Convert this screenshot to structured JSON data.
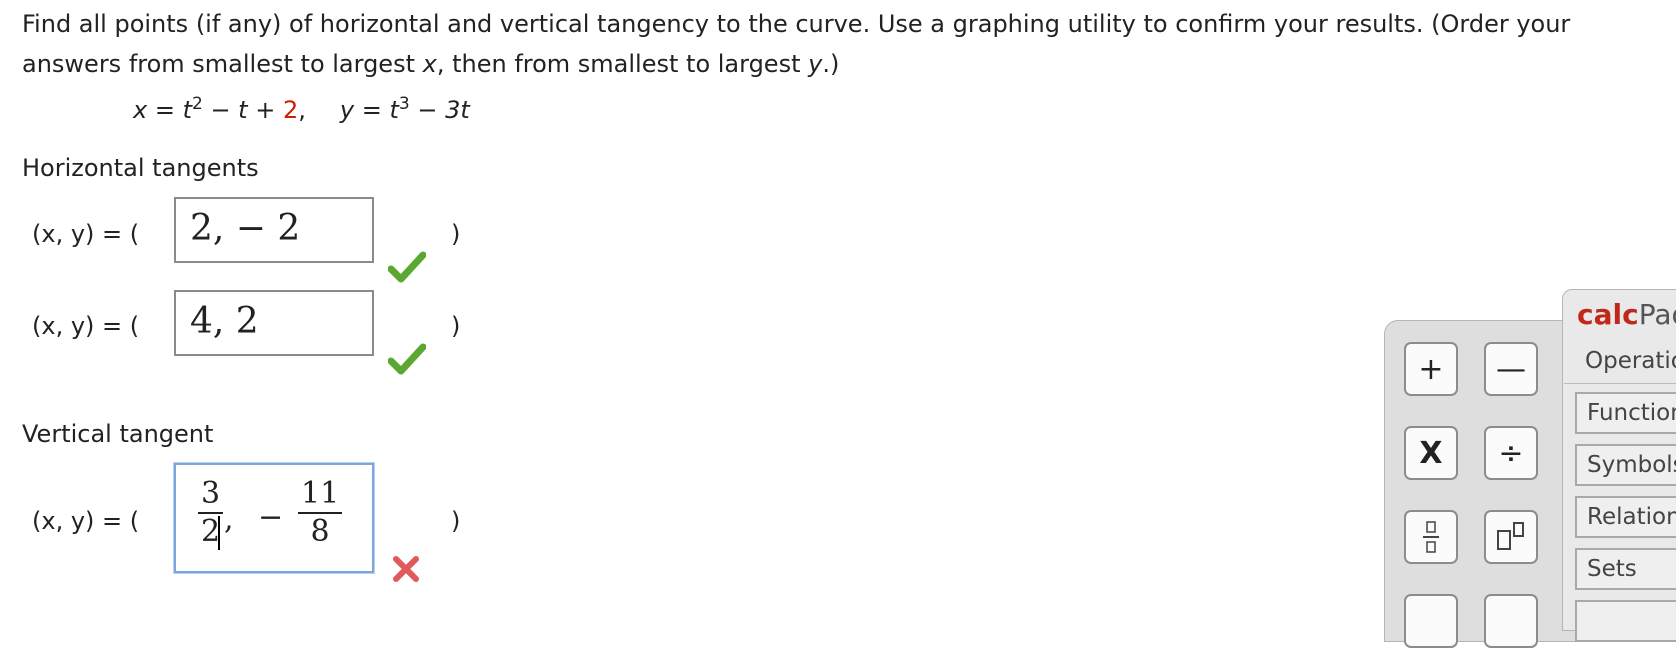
{
  "question": {
    "part1": "Find all points (if any) of horizontal and vertical tangency to the curve. Use a graphing utility to confirm your results. (Order your answers from smallest to largest ",
    "var_x": "x",
    "part2": ", then from smallest to largest ",
    "var_y": "y",
    "part3": ".)"
  },
  "equation": {
    "x_lhs": "x = t",
    "x_exp": "2",
    "x_mid": " − t + ",
    "x_const": "2",
    "x_comma": ",",
    "y_lhs": "y = t",
    "y_exp": "3",
    "y_rest": " − 3t"
  },
  "horizontal": {
    "label": "Horizontal tangents",
    "rows": [
      {
        "prefix": "(x, y)  =  (",
        "answer": "2,  − 2",
        "suffix": ")",
        "status": "correct"
      },
      {
        "prefix": "(x, y)  =  (",
        "answer": "4, 2",
        "suffix": ")",
        "status": "correct"
      }
    ]
  },
  "vertical": {
    "label": "Vertical tangent",
    "prefix": "(x, y)  =  (",
    "answer": {
      "x_num": "3",
      "x_den": "2",
      "comma": ",",
      "minus": "−",
      "y_num": "11",
      "y_den": "8"
    },
    "suffix": ")",
    "status": "incorrect"
  },
  "calcpad": {
    "title_calc": "calc",
    "title_pad": "Pad",
    "menu": [
      "Operations",
      "Functions",
      "Symbols",
      "Relations",
      "Sets"
    ],
    "buttons": {
      "plus": "+",
      "minus": "—",
      "times": "X",
      "divide": "÷"
    }
  },
  "colors": {
    "check": "#5aa832",
    "cross": "#e05a5a",
    "accent_red": "#cc2200",
    "active_border": "#7ea6db"
  }
}
